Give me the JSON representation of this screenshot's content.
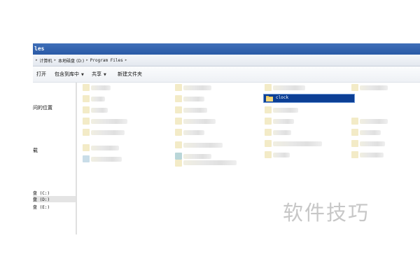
{
  "window": {
    "title": "les"
  },
  "address": {
    "crumbs": [
      "计算机",
      "本地磁盘 (D:)",
      "Program Files"
    ]
  },
  "toolbar": {
    "open_label": "打开",
    "include_label": "包含到库中",
    "share_label": "共享",
    "new_folder_label": "新建文件夹"
  },
  "nav": {
    "recent_places": "问的位置",
    "downloads": "载",
    "drives": [
      "盘 (C:)",
      "盘 (D:)",
      "盘 (E:)"
    ]
  },
  "content": {
    "selected_item": "clock"
  },
  "watermark": "软件技巧",
  "colors": {
    "selection": "#0c3f95",
    "titlebar": "#2a5aa6",
    "watermark": "#c7c7c7"
  },
  "icons": {
    "folder": "folder-icon",
    "breadcrumb_separator": "chevron-right-icon",
    "dropdown": "caret-down-icon"
  }
}
